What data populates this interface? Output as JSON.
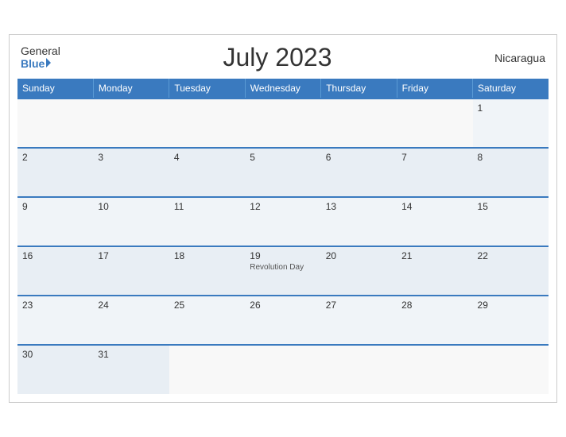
{
  "header": {
    "logo_general": "General",
    "logo_blue": "Blue",
    "title": "July 2023",
    "country": "Nicaragua"
  },
  "days_of_week": [
    "Sunday",
    "Monday",
    "Tuesday",
    "Wednesday",
    "Thursday",
    "Friday",
    "Saturday"
  ],
  "weeks": [
    [
      {
        "day": "",
        "empty": true
      },
      {
        "day": "",
        "empty": true
      },
      {
        "day": "",
        "empty": true
      },
      {
        "day": "",
        "empty": true
      },
      {
        "day": "",
        "empty": true
      },
      {
        "day": "",
        "empty": true
      },
      {
        "day": "1",
        "event": ""
      }
    ],
    [
      {
        "day": "2",
        "event": ""
      },
      {
        "day": "3",
        "event": ""
      },
      {
        "day": "4",
        "event": ""
      },
      {
        "day": "5",
        "event": ""
      },
      {
        "day": "6",
        "event": ""
      },
      {
        "day": "7",
        "event": ""
      },
      {
        "day": "8",
        "event": ""
      }
    ],
    [
      {
        "day": "9",
        "event": ""
      },
      {
        "day": "10",
        "event": ""
      },
      {
        "day": "11",
        "event": ""
      },
      {
        "day": "12",
        "event": ""
      },
      {
        "day": "13",
        "event": ""
      },
      {
        "day": "14",
        "event": ""
      },
      {
        "day": "15",
        "event": ""
      }
    ],
    [
      {
        "day": "16",
        "event": ""
      },
      {
        "day": "17",
        "event": ""
      },
      {
        "day": "18",
        "event": ""
      },
      {
        "day": "19",
        "event": "Revolution Day"
      },
      {
        "day": "20",
        "event": ""
      },
      {
        "day": "21",
        "event": ""
      },
      {
        "day": "22",
        "event": ""
      }
    ],
    [
      {
        "day": "23",
        "event": ""
      },
      {
        "day": "24",
        "event": ""
      },
      {
        "day": "25",
        "event": ""
      },
      {
        "day": "26",
        "event": ""
      },
      {
        "day": "27",
        "event": ""
      },
      {
        "day": "28",
        "event": ""
      },
      {
        "day": "29",
        "event": ""
      }
    ],
    [
      {
        "day": "30",
        "event": ""
      },
      {
        "day": "31",
        "event": ""
      },
      {
        "day": "",
        "empty": true
      },
      {
        "day": "",
        "empty": true
      },
      {
        "day": "",
        "empty": true
      },
      {
        "day": "",
        "empty": true
      },
      {
        "day": "",
        "empty": true
      }
    ]
  ]
}
